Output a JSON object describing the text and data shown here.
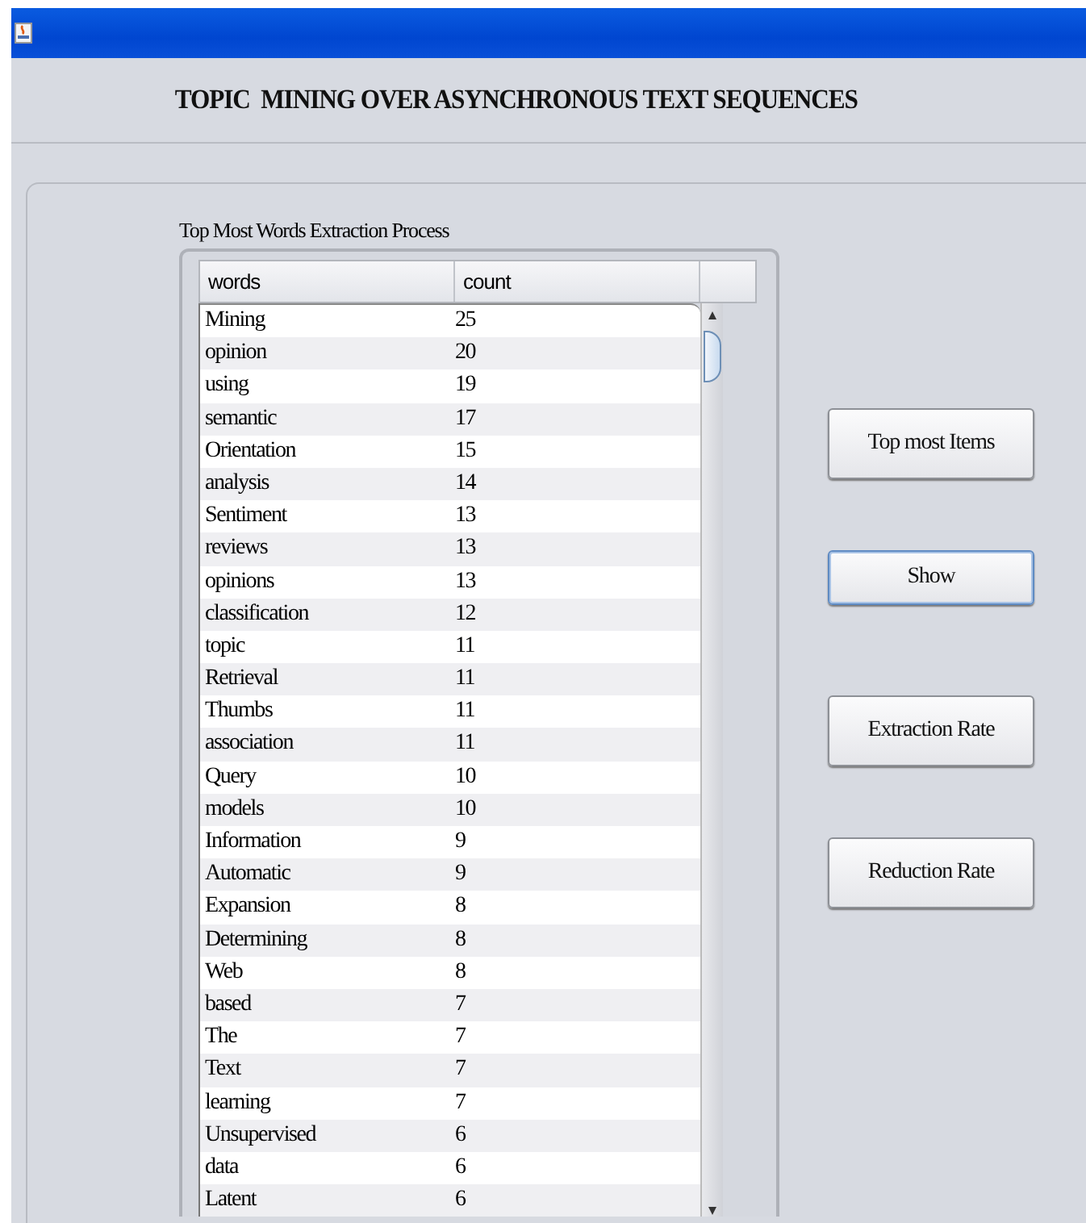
{
  "window": {
    "title": "TOPIC  MINING OVER ASYNCHRONOUS TEXT SEQUENCES"
  },
  "panel": {
    "label": "Top Most Words Extraction Process"
  },
  "table": {
    "columns": [
      "words",
      "count"
    ],
    "rows": [
      [
        "Mining",
        "25"
      ],
      [
        "opinion",
        "20"
      ],
      [
        "using",
        "19"
      ],
      [
        "semantic",
        "17"
      ],
      [
        "Orientation",
        "15"
      ],
      [
        "analysis",
        "14"
      ],
      [
        "Sentiment",
        "13"
      ],
      [
        "reviews",
        "13"
      ],
      [
        "opinions",
        "13"
      ],
      [
        "classification",
        "12"
      ],
      [
        "topic",
        "11"
      ],
      [
        "Retrieval",
        "11"
      ],
      [
        "Thumbs",
        "11"
      ],
      [
        "association",
        "11"
      ],
      [
        "Query",
        "10"
      ],
      [
        "models",
        "10"
      ],
      [
        "Information",
        "9"
      ],
      [
        "Automatic",
        "9"
      ],
      [
        "Expansion",
        "8"
      ],
      [
        "Determining",
        "8"
      ],
      [
        "Web",
        "8"
      ],
      [
        "based",
        "7"
      ],
      [
        "The",
        "7"
      ],
      [
        "Text",
        "7"
      ],
      [
        "learning",
        "7"
      ],
      [
        "Unsupervised",
        "6"
      ],
      [
        "data",
        "6"
      ],
      [
        "Latent",
        "6"
      ]
    ]
  },
  "buttons": [
    {
      "label": "Top most Items",
      "focused": false
    },
    {
      "label": "Show",
      "focused": true
    },
    {
      "label": "Extraction Rate",
      "focused": false
    },
    {
      "label": "Reduction Rate",
      "focused": false
    }
  ]
}
